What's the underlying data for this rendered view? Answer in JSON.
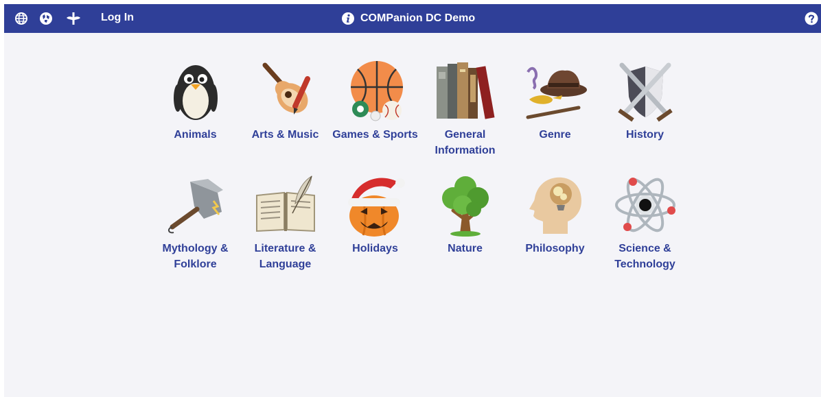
{
  "header": {
    "login_label": "Log In",
    "title": "COMPanion DC Demo",
    "icons": [
      "globe-icon",
      "worldcat-icon",
      "bookmark-flag-icon",
      "info-icon",
      "help-icon"
    ]
  },
  "colors": {
    "header_bg": "#2f3f98",
    "label": "#2f3f98",
    "page_bg": "#f4f4f8"
  },
  "categories": [
    {
      "label": "Animals",
      "icon": "penguin-icon"
    },
    {
      "label": "Arts & Music",
      "icon": "guitar-icon"
    },
    {
      "label": "Games & Sports",
      "icon": "sports-balls-icon"
    },
    {
      "label": "General Information",
      "icon": "books-icon"
    },
    {
      "label": "Genre",
      "icon": "magic-lamp-hat-icon"
    },
    {
      "label": "History",
      "icon": "shield-swords-icon"
    },
    {
      "label": "Mythology & Folklore",
      "icon": "hammer-icon"
    },
    {
      "label": "Literature & Language",
      "icon": "open-book-quill-icon"
    },
    {
      "label": "Holidays",
      "icon": "pumpkin-santa-hat-icon"
    },
    {
      "label": "Nature",
      "icon": "tree-icon"
    },
    {
      "label": "Philosophy",
      "icon": "head-lightbulb-icon"
    },
    {
      "label": "Science & Technology",
      "icon": "atom-icon"
    }
  ]
}
